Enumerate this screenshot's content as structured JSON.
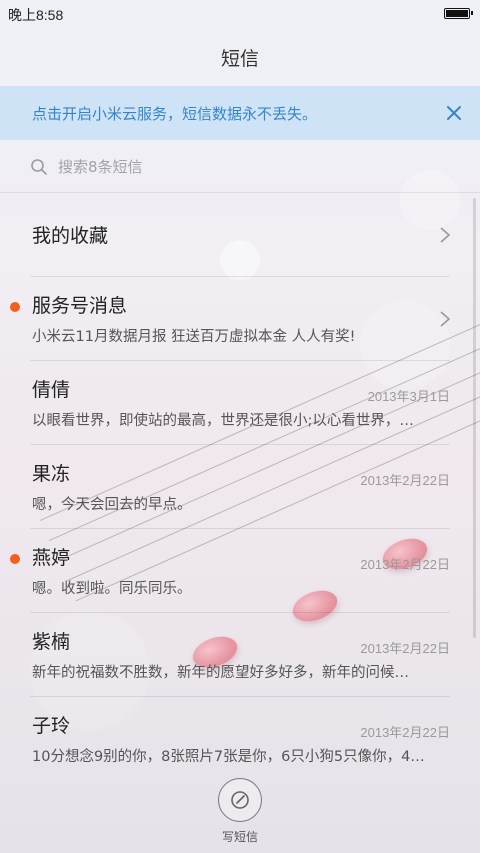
{
  "status_bar": {
    "time": "晚上8:58"
  },
  "header": {
    "title": "短信"
  },
  "banner": {
    "text": "点击开启小米云服务，短信数据永不丢失。"
  },
  "search": {
    "placeholder": "搜索8条短信"
  },
  "favorites": {
    "label": "我的收藏"
  },
  "conversations": [
    {
      "name": "服务号消息",
      "preview": "小米云11月数据月报 狂送百万虚拟本金 人人有奖!",
      "date": "",
      "unread": true,
      "chevron": true
    },
    {
      "name": "倩倩",
      "preview": "以眼看世界，即使站的最高，世界还是很小;以心看世界，…",
      "date": "2013年3月1日",
      "unread": false,
      "chevron": false
    },
    {
      "name": "果冻",
      "preview": "嗯，今天会回去的早点。",
      "date": "2013年2月22日",
      "unread": false,
      "chevron": false
    },
    {
      "name": "燕婷",
      "preview": "嗯。收到啦。同乐同乐。",
      "date": "2013年2月22日",
      "unread": true,
      "chevron": false
    },
    {
      "name": "紫楠",
      "preview": "新年的祝福数不胜数，新年的愿望好多好多，新年的问候…",
      "date": "2013年2月22日",
      "unread": false,
      "chevron": false
    },
    {
      "name": "子玲",
      "preview": "10分想念9别的你，8张照片7张是你，6只小狗5只像你，4…",
      "date": "2013年2月22日",
      "unread": false,
      "chevron": false
    }
  ],
  "compose": {
    "label": "写短信"
  },
  "colors": {
    "accent": "#3585c9",
    "unread_dot": "#f25f1f",
    "banner_bg": "#c8e0f4"
  },
  "icons": {
    "search": "search-icon",
    "close": "close-icon",
    "chevron": "chevron-right-icon",
    "compose": "compose-icon",
    "battery": "battery-icon"
  }
}
